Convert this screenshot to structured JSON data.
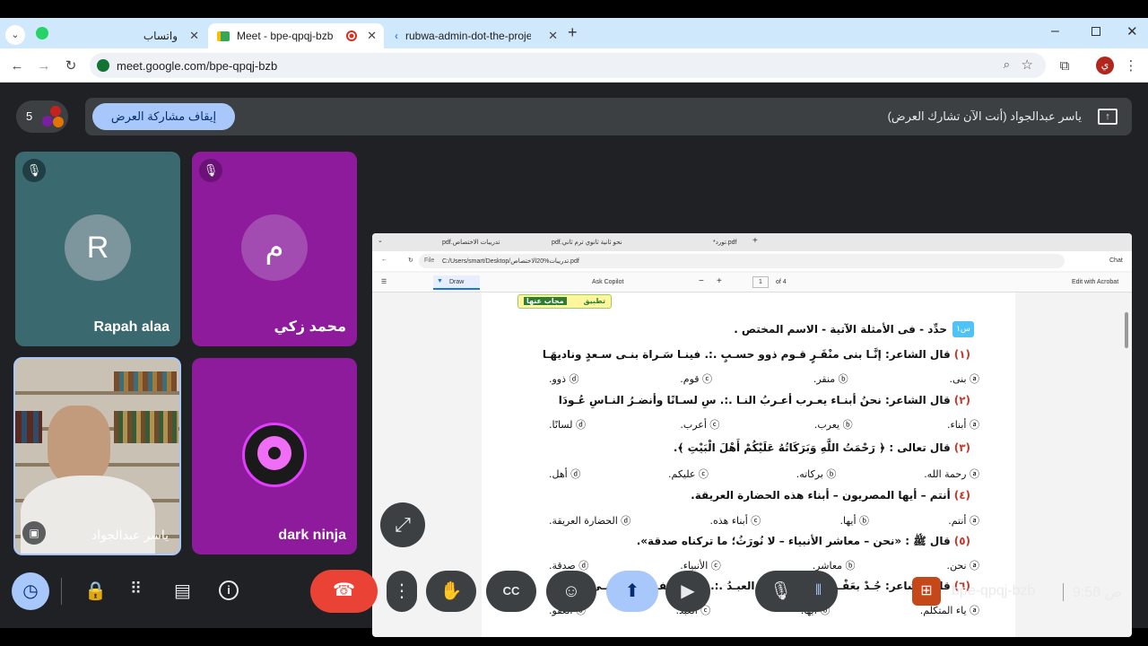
{
  "browser": {
    "tabs": [
      {
        "label": "واتساب",
        "close": "✕"
      },
      {
        "label": "Meet - bpe-qpqj-bzb",
        "close": "✕"
      },
      {
        "label": "rubwa-admin-dot-the-project-",
        "close": "✕"
      }
    ],
    "new_tab": "+",
    "url": "meet.google.com/bpe-qpqj-bzb"
  },
  "meet": {
    "participant_count": "5",
    "stop_sharing_label": "إيقاف مشاركة العرض",
    "presenting_text": "ياسر عبدالجواد (أنت الآن تشارك العرض)",
    "participants": [
      {
        "name": "Rapah alaa",
        "initial": "R"
      },
      {
        "name": "محمد زكي",
        "initial": "م"
      },
      {
        "name": "ياسر عبدالجواد"
      },
      {
        "name": "dark ninja"
      }
    ],
    "meeting_code": "bpe-qpqj-bzb",
    "time": "9:58",
    "ampm": "ص"
  },
  "pdf_viewer": {
    "tabs": [
      "تدريبات الاختصاص.pdf",
      "نحو ثانية ثانوي ترم ثاني.pdf",
      "*تورد.pdf"
    ],
    "path_label": "File",
    "path": "C:/Users/smart/Desktop/تدريبات%20الاختصاص.pdf",
    "draw_label": "Draw",
    "copilot_label": "Ask Copilot",
    "page_num": "1",
    "page_total": "of 4",
    "acrobat_label": "Edit with Acrobat",
    "chat_label": "Chat"
  },
  "document": {
    "banner": [
      "تطبيق",
      "مجاب عنها"
    ],
    "heading": "حدِّد - فى الأمثلة الآتية - الاسم المختص .",
    "questions": [
      {
        "num": "(١)",
        "text": "قال الشاعر: إنَّـا بنى منْقَـرٍ قـوم ذوو حسـبٍ  .:.  فينـا سَـراة بنـى سـعدٍ وناديهَـا",
        "options": [
          "ⓐ بنى.",
          "ⓑ منقر.",
          "ⓒ قوم.",
          "ⓓ ذوو."
        ]
      },
      {
        "num": "(٢)",
        "text": "قال الشاعر: نحنُ أبنـاء يعـرب أعـربُ النـا  .:.  سِ لسـانًا وأنضـرُ النـاسِ عُـودَا",
        "options": [
          "ⓐ أبناء.",
          "ⓑ يعرب.",
          "ⓒ أعرب.",
          "ⓓ لسانًا."
        ]
      },
      {
        "num": "(٣)",
        "text": "قال تعالى : ﴿ رَحْمَتُ اللَّهِ وَبَرَكَاتُهُ عَلَيْكُمْ أَهْلَ الْبَيْتِ ﴾.",
        "options": [
          "ⓐ رحمة الله.",
          "ⓑ بركاته.",
          "ⓒ عليكم.",
          "ⓓ أهل."
        ]
      },
      {
        "num": "(٤)",
        "text": "أنتم – أيها المصريون – أبناء هذه الحضارة العريقة.",
        "options": [
          "ⓐ أنتم.",
          "ⓑ أيها.",
          "ⓒ أبناء هذه.",
          "ⓓ الحضارة العريقة."
        ]
      },
      {
        "num": "(٥)",
        "text": "قال ﷺ : «نحن – معاشر الأنبياء – لا نُورَثُ؛ ما تركناه صدقة».",
        "options": [
          "ⓐ نحن.",
          "ⓑ معاشر.",
          "ⓒ الأنبياء.",
          "ⓓ صدقة."
        ]
      },
      {
        "num": "(٦)",
        "text": "قال الشاعر: جُـدْ بعَفْـوٍ فإنَّنـى – أيُّهـا العبـدُ  .:.  إلـى العفـوِ – يـا إلَهـى فقيـرُ",
        "options": [
          "ⓐ ياء المتكلم.",
          "ⓑ أيها.",
          "ⓒ العبد.",
          "ⓓ العفو."
        ]
      }
    ]
  },
  "colors": {
    "accent": "#a8c7fa",
    "end_call": "#ea4335",
    "tab_bg": "#cfe8fc"
  }
}
